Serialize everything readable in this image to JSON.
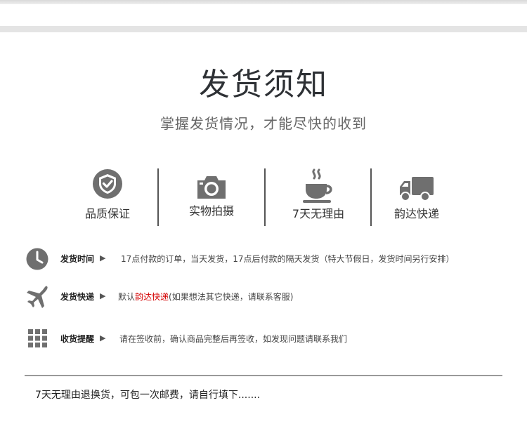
{
  "title": "发货须知",
  "subtitle": "掌握发货情况，才能尽快的收到",
  "features": [
    {
      "label": "品质保证",
      "icon": "shield-check-icon"
    },
    {
      "label": "实物拍摄",
      "icon": "camera-icon"
    },
    {
      "label": "7天无理由",
      "icon": "coffee-cup-icon"
    },
    {
      "label": "韵达快递",
      "icon": "delivery-truck-icon"
    }
  ],
  "info": {
    "shipping_time": {
      "key": "发货时间",
      "arrow": "▶",
      "text": "17点付款的订单，当天发货，17点后付款的隔天发货（特大节假日，发货时间另行安排）",
      "icon": "clock-icon"
    },
    "express": {
      "key": "发货快递",
      "arrow": "▶",
      "prefix": "默认",
      "highlight": "韵达快递",
      "suffix": "(如果想法其它快递，请联系客服)",
      "icon": "airplane-icon"
    },
    "receipt": {
      "key": "收货提醒",
      "arrow": "▶",
      "text": "请在签收前，确认商品完整后再签收，如发现问题请联系我们",
      "icon": "grid-icon"
    }
  },
  "note": "7天无理由退换货，可包一次邮费，请自行填下.......",
  "colors": {
    "highlight": "#d40000",
    "icon_gray": "#6f6f6f",
    "title": "#2e3135"
  }
}
